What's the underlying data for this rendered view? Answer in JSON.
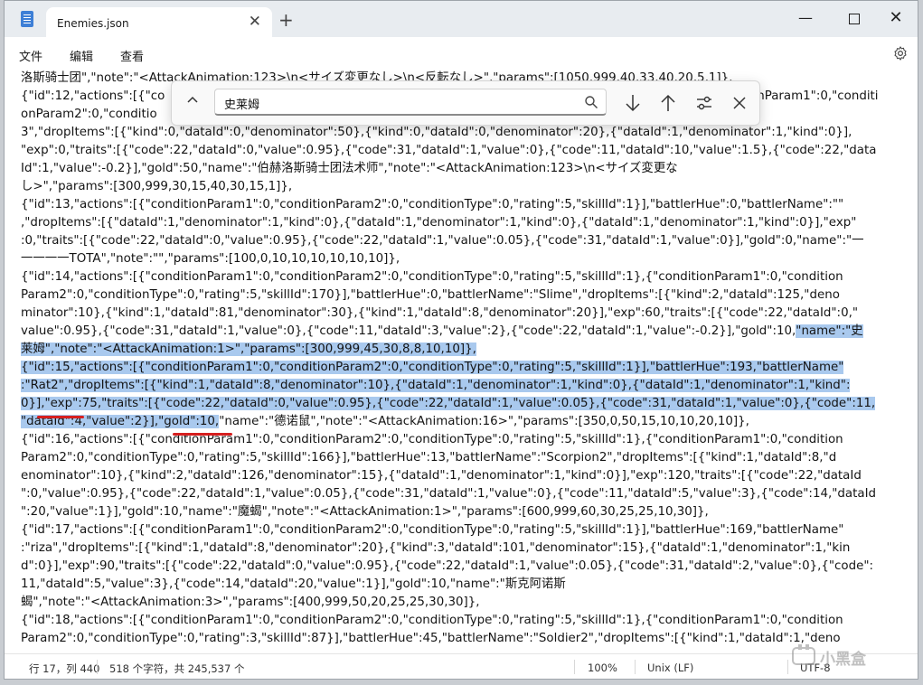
{
  "tab": {
    "title": "Enemies.json"
  },
  "menu": {
    "file": "文件",
    "edit": "编辑",
    "view": "查看"
  },
  "find": {
    "query": "史莱姆"
  },
  "editor": {
    "lines": [
      {
        "segments": [
          {
            "text": "洛斯骑士团\",\"note\":\"<AttackAnimation:123>\\n<サイズ変更なし>\\n<反転なし>\",\"params\":[1050,999,40,33,40,20,5,1]},"
          }
        ]
      },
      {
        "segments": [
          {
            "text": "{\"id\":12,\"actions\":[{\"co"
          },
          {
            "text": "nditionParam1\":0,\"conditi"
          }
        ]
      },
      {
        "segments": [
          {
            "text": "onParam2\":0,\"conditio"
          }
        ]
      },
      {
        "segments": [
          {
            "text": "3\",\"dropItems\":[{\"kind\":0,\"dataId\":0,\"denominator\":50},{\"kind\":0,\"dataId\":0,\"denominator\":20},{\"dataId\":1,\"denominator\":1,\"kind\":0}],"
          }
        ]
      },
      {
        "segments": [
          {
            "text": "\"exp\":0,\"traits\":[{\"code\":22,\"dataId\":0,\"value\":0.95},{\"code\":31,\"dataId\":1,\"value\":0},{\"code\":11,\"dataId\":10,\"value\":1.5},{\"code\":22,\"data"
          }
        ]
      },
      {
        "segments": [
          {
            "text": "Id\":1,\"value\":-0.2}],\"gold\":50,\"name\":\"伯赫洛斯骑士团法术师\",\"note\":\"<AttackAnimation:123>\\n<サイズ変更な"
          }
        ]
      },
      {
        "segments": [
          {
            "text": "し>\",\"params\":[300,999,30,15,40,30,15,1]},"
          }
        ]
      },
      {
        "segments": [
          {
            "text": "{\"id\":13,\"actions\":[{\"conditionParam1\":0,\"conditionParam2\":0,\"conditionType\":0,\"rating\":5,\"skillId\":1}],\"battlerHue\":0,\"battlerName\":\"\""
          }
        ]
      },
      {
        "segments": [
          {
            "text": ",\"dropItems\":[{\"dataId\":1,\"denominator\":1,\"kind\":0},{\"dataId\":1,\"denominator\":1,\"kind\":0},{\"dataId\":1,\"denominator\":1,\"kind\":0}],\"exp\""
          }
        ]
      },
      {
        "segments": [
          {
            "text": ":0,\"traits\":[{\"code\":22,\"dataId\":0,\"value\":0.95},{\"code\":22,\"dataId\":1,\"value\":0.05},{\"code\":31,\"dataId\":1,\"value\":0}],\"gold\":0,\"name\":\"一"
          }
        ]
      },
      {
        "segments": [
          {
            "text": "一一一一TOTA\",\"note\":\"\",\"params\":[100,0,10,10,10,10,10,10]},"
          }
        ]
      },
      {
        "segments": [
          {
            "text": "{\"id\":14,\"actions\":[{\"conditionParam1\":0,\"conditionParam2\":0,\"conditionType\":0,\"rating\":5,\"skillId\":1},{\"conditionParam1\":0,\"condition"
          }
        ]
      },
      {
        "segments": [
          {
            "text": "Param2\":0,\"conditionType\":0,\"rating\":5,\"skillId\":170}],\"battlerHue\":0,\"battlerName\":\"Slime\",\"dropItems\":[{\"kind\":2,\"dataId\":125,\"deno"
          }
        ]
      },
      {
        "segments": [
          {
            "text": "minator\":10},{\"kind\":1,\"dataId\":81,\"denominator\":30},{\"kind\":1,\"dataId\":8,\"denominator\":20}],\"exp\":60,\"traits\":[{\"code\":22,\"dataId\":0,\""
          }
        ]
      },
      {
        "segments": [
          {
            "text": "value\":0.95},{\"code\":31,\"dataId\":1,\"value\":0},{\"code\":11,\"dataId\":3,\"value\":2},{\"code\":22,\"dataId\":1,\"value\":-0.2}],\"gold\":10,"
          },
          {
            "text": "\"name\":\"史",
            "hl": true
          }
        ]
      },
      {
        "segments": [
          {
            "text": "莱姆\",\"note\":\"<AttackAnimation:1>\",\"params\":[300,999,45,30,8,8,10,10]},",
            "hl": true
          }
        ]
      },
      {
        "segments": [
          {
            "text": "{\"id\":15,\"actions\":[{\"conditionParam1\":0,\"conditionParam2\":0,\"conditionType\":0,\"rating\":5,\"skillId\":1}],\"battlerHue\":193,\"battlerName\"",
            "hl": true
          }
        ]
      },
      {
        "segments": [
          {
            "text": ":\"Rat2\",\"dropItems\":[{\"kind\":1,\"dataId\":8,\"denominator\":10},{\"dataId\":1,\"denominator\":1,\"kind\":0},{\"dataId\":1,\"denominator\":1,\"kind\":",
            "hl": true
          }
        ]
      },
      {
        "segments": [
          {
            "text": "0}],\"exp\":75,\"traits\":[{\"code\":22,\"dataId\":0,\"value\":0.95},{\"code\":22,\"dataId\":1,\"value\":0.05},{\"code\":31,\"dataId\":1,\"value\":0},{\"code\":11,",
            "hl": true
          }
        ]
      },
      {
        "segments": [
          {
            "text": "\"dataId\":4,\"value\":2}],\"gold\":10,",
            "hl": true
          },
          {
            "text": "\"name\":\"德诺鼠\",\"note\":\"<AttackAnimation:16>\",\"params\":[350,0,50,15,10,10,20,10]},"
          }
        ]
      },
      {
        "segments": [
          {
            "text": "{\"id\":16,\"actions\":[{\"conditionParam1\":0,\"conditionParam2\":0,\"conditionType\":0,\"rating\":5,\"skillId\":1},{\"conditionParam1\":0,\"condition"
          }
        ]
      },
      {
        "segments": [
          {
            "text": "Param2\":0,\"conditionType\":0,\"rating\":5,\"skillId\":166}],\"battlerHue\":13,\"battlerName\":\"Scorpion2\",\"dropItems\":[{\"kind\":1,\"dataId\":8,\"d"
          }
        ]
      },
      {
        "segments": [
          {
            "text": "enominator\":10},{\"kind\":2,\"dataId\":126,\"denominator\":15},{\"dataId\":1,\"denominator\":1,\"kind\":0}],\"exp\":120,\"traits\":[{\"code\":22,\"dataId"
          }
        ]
      },
      {
        "segments": [
          {
            "text": "\":0,\"value\":0.95},{\"code\":22,\"dataId\":1,\"value\":0.05},{\"code\":31,\"dataId\":1,\"value\":0},{\"code\":11,\"dataId\":5,\"value\":3},{\"code\":14,\"dataId"
          }
        ]
      },
      {
        "segments": [
          {
            "text": "\":20,\"value\":1}],\"gold\":10,\"name\":\"魔蝎\",\"note\":\"<AttackAnimation:1>\",\"params\":[600,999,60,30,25,25,10,30]},"
          }
        ]
      },
      {
        "segments": [
          {
            "text": "{\"id\":17,\"actions\":[{\"conditionParam1\":0,\"conditionParam2\":0,\"conditionType\":0,\"rating\":5,\"skillId\":1}],\"battlerHue\":169,\"battlerName\""
          }
        ]
      },
      {
        "segments": [
          {
            "text": ":\"riza\",\"dropItems\":[{\"kind\":1,\"dataId\":8,\"denominator\":20},{\"kind\":3,\"dataId\":101,\"denominator\":15},{\"dataId\":1,\"denominator\":1,\"kin"
          }
        ]
      },
      {
        "segments": [
          {
            "text": "d\":0}],\"exp\":90,\"traits\":[{\"code\":22,\"dataId\":0,\"value\":0.95},{\"code\":22,\"dataId\":1,\"value\":0.05},{\"code\":31,\"dataId\":2,\"value\":0},{\"code\":"
          }
        ]
      },
      {
        "segments": [
          {
            "text": "11,\"dataId\":5,\"value\":3},{\"code\":14,\"dataId\":20,\"value\":1}],\"gold\":10,\"name\":\"斯克阿诺斯"
          }
        ]
      },
      {
        "segments": [
          {
            "text": "蝎\",\"note\":\"<AttackAnimation:3>\",\"params\":[400,999,50,20,25,25,30,30]},"
          }
        ]
      },
      {
        "segments": [
          {
            "text": "{\"id\":18,\"actions\":[{\"conditionParam1\":0,\"conditionParam2\":0,\"conditionType\":0,\"rating\":5,\"skillId\":1},{\"conditionParam1\":0,\"condition"
          }
        ]
      },
      {
        "segments": [
          {
            "text": "Param2\":0,\"conditionType\":0,\"rating\":3,\"skillId\":87}],\"battlerHue\":45,\"battlerName\":\"Soldier2\",\"dropItems\":[{\"kind\":1,\"dataId\":1,\"deno"
          }
        ]
      }
    ]
  },
  "status": {
    "position": "行 17，列 440",
    "count": "518 个字符，共 245,537 个",
    "zoom": "100%",
    "eol": "Unix (LF)",
    "encoding": "UTF-8"
  },
  "watermark": {
    "text": "小黑盒"
  },
  "colors": {
    "selection": "#a9c9ee",
    "underline": "#d61f1f",
    "accent": "#3d7fd6"
  }
}
